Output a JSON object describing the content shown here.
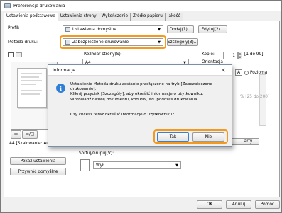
{
  "window": {
    "title": "Preferencje drukowania"
  },
  "tabs": [
    {
      "label": "Ustawienia podstawowe"
    },
    {
      "label": "Ustawienia strony"
    },
    {
      "label": "Wykończenie"
    },
    {
      "label": "Źródło papieru"
    },
    {
      "label": "Jakość"
    }
  ],
  "profile": {
    "label": "Profil:",
    "value": "Ustawienia domyślne",
    "add_button": "Dodaj(1)...",
    "edit_button": "Edytuj(2)..."
  },
  "output_method": {
    "label": "Metoda druku:",
    "value": "Zabezpieczone drukowanie",
    "details_button": "Szczegóły(3)..."
  },
  "page_size": {
    "label": "Rozmiar strony(S):",
    "value": "A4"
  },
  "copies": {
    "label": "Kopie:",
    "value": "1",
    "range": "[1 do 99]"
  },
  "orientation": {
    "label": "Orientacja",
    "landscape_label": "Pozioma",
    "landscape_icon_letter": "A"
  },
  "scale_fragment": "% [25 do 200]",
  "preview_caption": "A4 [Skalowanie: Auto]",
  "layout_fragment": "arty...",
  "collate": {
    "label": "Sortuj/Grupuj(V):",
    "value": "Wył"
  },
  "side_buttons": {
    "show_settings": "Pokaż ustawienia",
    "restore_defaults": "Przywróć domyślne"
  },
  "footer": {
    "ok": "OK",
    "cancel": "Anuluj",
    "help": "Pomoc"
  },
  "dialog": {
    "title": "Informacje",
    "icon_letter": "i",
    "close_glyph": "✕",
    "message_lines": [
      "Ustawienie Metoda druku zostanie przełączone na tryb [Zabezpieczone",
      "drukowanie].",
      "Kliknij przycisk [Szczegóły], aby określić informacje o użytkowniku.",
      "Wprowadź nazwę dokumentu, kod PIN, itd. podczas drukowania."
    ],
    "question": "Czy chcesz teraz określić informacje o użytkowniku?",
    "yes_button": "Tak",
    "no_button": "Nie"
  },
  "colors": {
    "highlight": "#f39a1e",
    "info_blue": "#2f7fd8"
  }
}
